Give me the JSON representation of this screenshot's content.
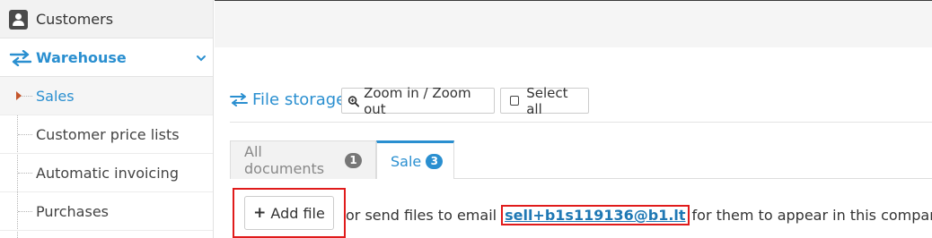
{
  "sidebar": {
    "customers_label": "Customers",
    "warehouse_label": "Warehouse",
    "items": [
      {
        "label": "Sales",
        "active": true
      },
      {
        "label": "Customer price lists"
      },
      {
        "label": "Automatic invoicing"
      },
      {
        "label": "Purchases"
      }
    ]
  },
  "file_storage": {
    "title": "File storage",
    "zoom_label": "Zoom in / Zoom out",
    "select_all_label": "Select all"
  },
  "tabs": [
    {
      "label": "All documents",
      "count": "1"
    },
    {
      "label": "Sale",
      "count": "3",
      "active": true
    }
  ],
  "upload": {
    "add_file_label": "Add file",
    "info_prefix": "or send files to email",
    "email": "sell+b1s119136@b1.lt",
    "info_suffix": "for them to appear in this company",
    "help_glyph": "?"
  },
  "colors": {
    "accent": "#2a8fd0",
    "highlight_box": "#e01b1b",
    "badge_gray": "#777777"
  },
  "icons": [
    "customers-icon",
    "warehouse-arrows-icon",
    "chevron-down-icon",
    "file-storage-arrows-icon",
    "zoom-icon",
    "checkbox-icon",
    "plus-icon",
    "help-icon"
  ]
}
